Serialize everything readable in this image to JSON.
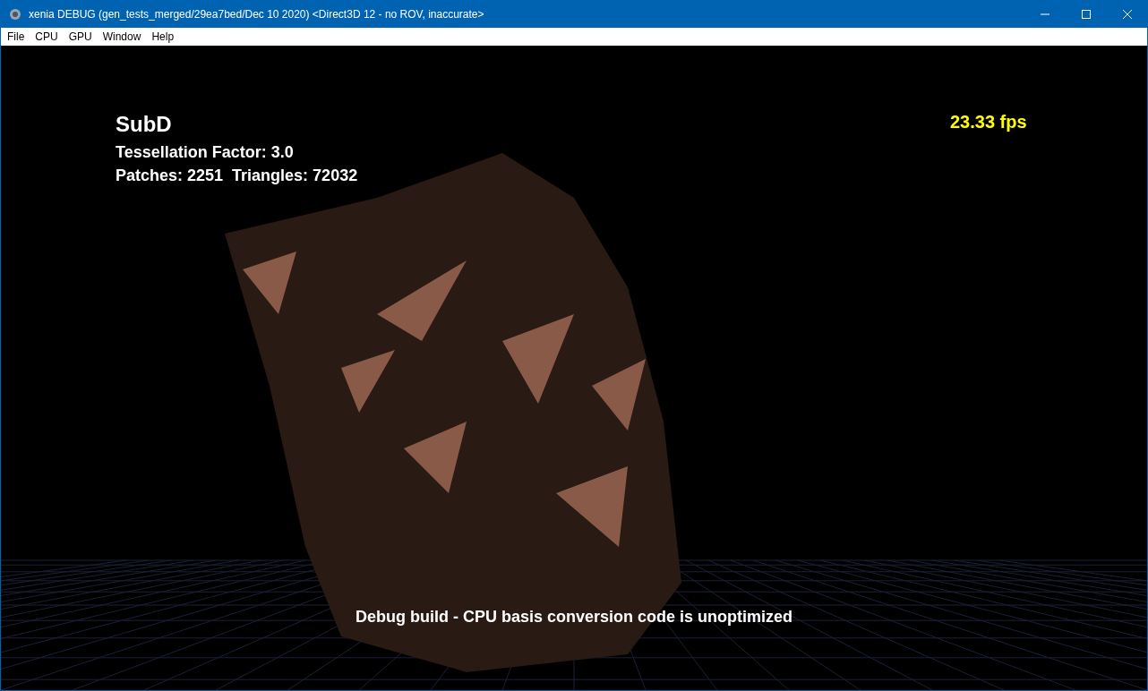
{
  "window": {
    "title": "xenia DEBUG (gen_tests_merged/29ea7bed/Dec 10 2020) <Direct3D 12 - no ROV, inaccurate>"
  },
  "menu": [
    "File",
    "CPU",
    "GPU",
    "Window",
    "Help"
  ],
  "overlay": {
    "title": "SubD",
    "lines": [
      "Tessellation Factor: 3.0",
      "Patches: 2251  Triangles: 72032"
    ],
    "fps": "23.33 fps",
    "footer": "Debug build - CPU basis conversion code is unoptimized"
  }
}
